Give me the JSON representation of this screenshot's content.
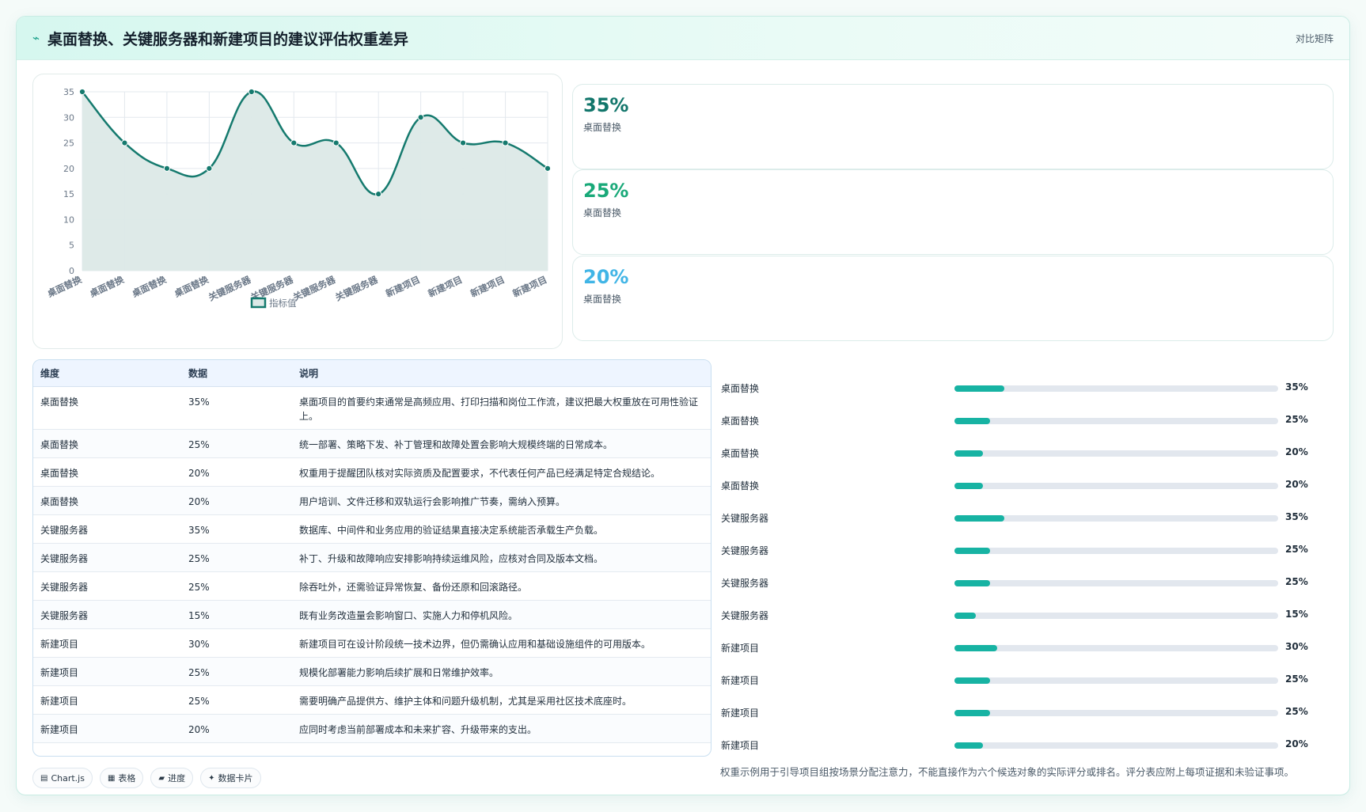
{
  "header": {
    "title": "桌面替换、关键服务器和新建项目的建议评估权重差异",
    "mode": "对比矩阵"
  },
  "colors": {
    "line": "#157a6e",
    "fill": "#dce9e7",
    "accent": "#17b3a3"
  },
  "chart_data": {
    "type": "line",
    "categories": [
      "桌面替换",
      "桌面替换",
      "桌面替换",
      "桌面替换",
      "关键服务器",
      "关键服务器",
      "关键服务器",
      "关键服务器",
      "新建项目",
      "新建项目",
      "新建项目",
      "新建项目"
    ],
    "series": [
      {
        "name": "指标值",
        "values": [
          35,
          25,
          20,
          20,
          35,
          25,
          25,
          15,
          30,
          25,
          25,
          20
        ]
      }
    ],
    "ylim": [
      0,
      35
    ],
    "yticks": [
      0,
      5,
      10,
      15,
      20,
      25,
      30,
      35
    ],
    "legend": "bottom",
    "grid": true,
    "fill": true
  },
  "stats": [
    {
      "value": "35%",
      "label": "桌面替换",
      "color": "#12766b"
    },
    {
      "value": "25%",
      "label": "桌面替换",
      "color": "#19a979"
    },
    {
      "value": "20%",
      "label": "桌面替换",
      "color": "#41b5e6"
    }
  ],
  "table": {
    "headers": [
      "维度",
      "数据",
      "说明"
    ],
    "rows": [
      {
        "dim": "桌面替换",
        "value": "35%",
        "desc": "桌面项目的首要约束通常是高频应用、打印扫描和岗位工作流，建议把最大权重放在可用性验证上。"
      },
      {
        "dim": "桌面替换",
        "value": "25%",
        "desc": "统一部署、策略下发、补丁管理和故障处置会影响大规模终端的日常成本。"
      },
      {
        "dim": "桌面替换",
        "value": "20%",
        "desc": "权重用于提醒团队核对实际资质及配置要求，不代表任何产品已经满足特定合规结论。"
      },
      {
        "dim": "桌面替换",
        "value": "20%",
        "desc": "用户培训、文件迁移和双轨运行会影响推广节奏，需纳入预算。"
      },
      {
        "dim": "关键服务器",
        "value": "35%",
        "desc": "数据库、中间件和业务应用的验证结果直接决定系统能否承载生产负载。"
      },
      {
        "dim": "关键服务器",
        "value": "25%",
        "desc": "补丁、升级和故障响应安排影响持续运维风险，应核对合同及版本文档。"
      },
      {
        "dim": "关键服务器",
        "value": "25%",
        "desc": "除吞吐外，还需验证异常恢复、备份还原和回滚路径。"
      },
      {
        "dim": "关键服务器",
        "value": "15%",
        "desc": "既有业务改造量会影响窗口、实施人力和停机风险。"
      },
      {
        "dim": "新建项目",
        "value": "30%",
        "desc": "新建项目可在设计阶段统一技术边界，但仍需确认应用和基础设施组件的可用版本。"
      },
      {
        "dim": "新建项目",
        "value": "25%",
        "desc": "规模化部署能力影响后续扩展和日常维护效率。"
      },
      {
        "dim": "新建项目",
        "value": "25%",
        "desc": "需要明确产品提供方、维护主体和问题升级机制，尤其是采用社区技术底座时。"
      },
      {
        "dim": "新建项目",
        "value": "20%",
        "desc": "应同时考虑当前部署成本和未来扩容、升级带来的支出。"
      }
    ]
  },
  "progress": [
    {
      "label": "桌面替换",
      "value": "35%",
      "frac": 0.35
    },
    {
      "label": "桌面替换",
      "value": "25%",
      "frac": 0.25
    },
    {
      "label": "桌面替换",
      "value": "20%",
      "frac": 0.2
    },
    {
      "label": "桌面替换",
      "value": "20%",
      "frac": 0.2
    },
    {
      "label": "关键服务器",
      "value": "35%",
      "frac": 0.35
    },
    {
      "label": "关键服务器",
      "value": "25%",
      "frac": 0.25
    },
    {
      "label": "关键服务器",
      "value": "25%",
      "frac": 0.25
    },
    {
      "label": "关键服务器",
      "value": "15%",
      "frac": 0.15
    },
    {
      "label": "新建项目",
      "value": "30%",
      "frac": 0.3
    },
    {
      "label": "新建项目",
      "value": "25%",
      "frac": 0.25
    },
    {
      "label": "新建项目",
      "value": "25%",
      "frac": 0.25
    },
    {
      "label": "新建项目",
      "value": "20%",
      "frac": 0.2
    }
  ],
  "note": "权重示例用于引导项目组按场景分配注意力，不能直接作为六个候选对象的实际评分或排名。评分表应附上每项证据和未验证事项。",
  "badges": [
    {
      "icon": "▤",
      "icon_name": "chart-icon",
      "label": "Chart.js"
    },
    {
      "icon": "▦",
      "icon_name": "table-icon",
      "label": "表格"
    },
    {
      "icon": "▰",
      "icon_name": "progress-icon",
      "label": "进度"
    },
    {
      "icon": "✦",
      "icon_name": "card-icon",
      "label": "数据卡片"
    }
  ]
}
